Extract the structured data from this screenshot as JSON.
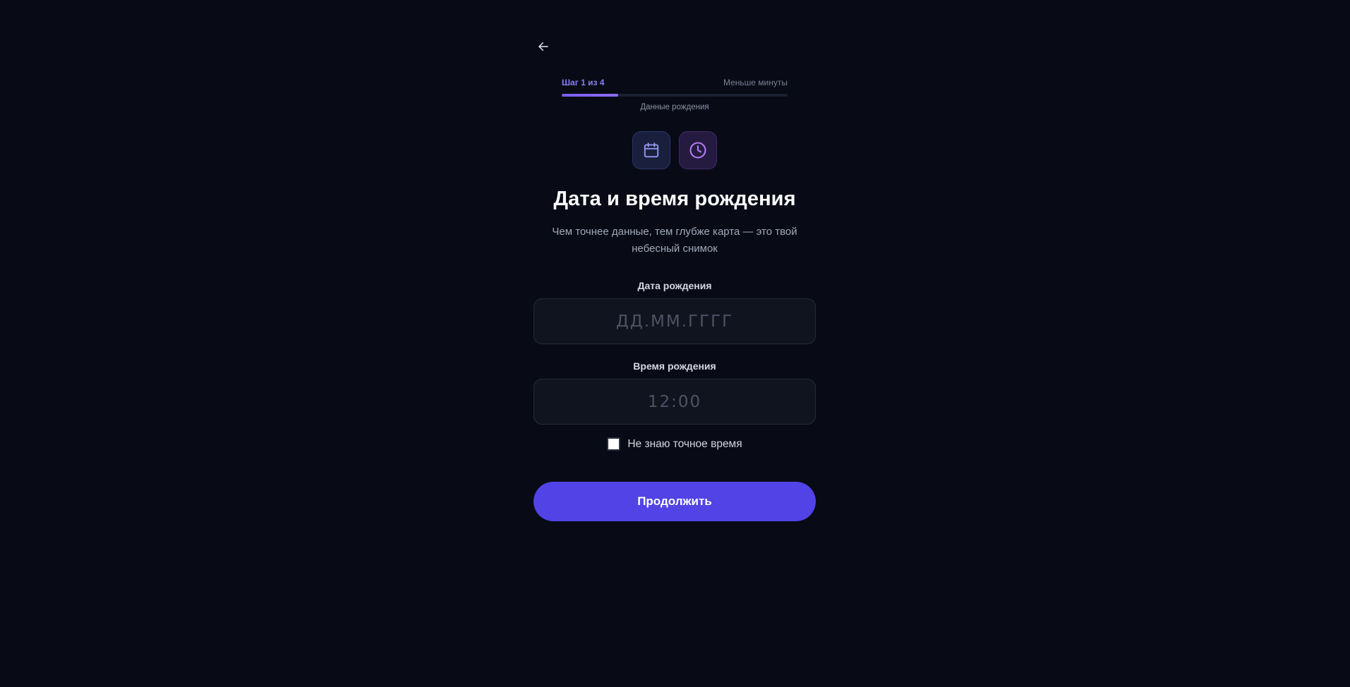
{
  "header": {
    "back_icon": "arrow-left-icon"
  },
  "progress": {
    "step_label": "Шаг 1 из 4",
    "time_estimate": "Меньше минуты",
    "step_name": "Данные рождения",
    "current_step": 1,
    "total_steps": 4,
    "fill_fraction": 0.25,
    "accent_color": "#7b5cf0"
  },
  "icons": {
    "calendar": "calendar-icon",
    "clock": "clock-icon"
  },
  "title": "Дата и время рождения",
  "subtitle": "Чем точнее данные, тем глубже карта — это твой небесный снимок",
  "form": {
    "date": {
      "label": "Дата рождения",
      "value": "",
      "placeholder": "ДД.ММ.ГГГГ"
    },
    "time": {
      "label": "Время рождения",
      "value": "",
      "placeholder": "12:00"
    },
    "unknown_time": {
      "label": "Не знаю точное время",
      "checked": false
    }
  },
  "continue_button": {
    "label": "Продолжить",
    "color": "#5143e6"
  }
}
